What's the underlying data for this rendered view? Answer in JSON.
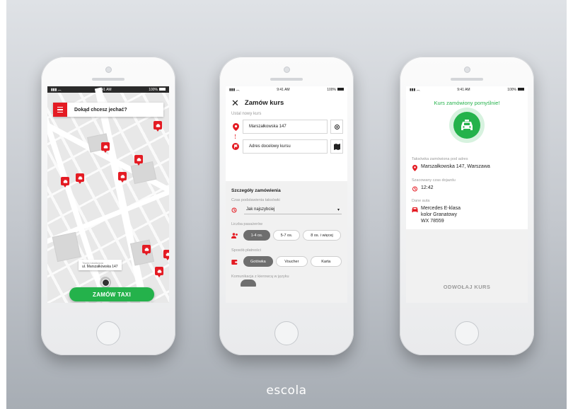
{
  "colors": {
    "brand_red": "#e41b23",
    "success_green": "#24b24b"
  },
  "status_bar": {
    "time": "9:41 AM",
    "battery": "100%"
  },
  "map_screen": {
    "search_placeholder": "Dokąd chcesz jechać?",
    "location_label": "Twoja lokalizacja",
    "location_value": "ul. Marszałkowska 147",
    "order_button": "ZAMÓW TAXI",
    "icons": [
      "menu-icon",
      "taxi-pin-icon",
      "current-location-icon"
    ]
  },
  "order_screen": {
    "title": "Zamów kurs",
    "subtitle": "Ustal nowy kurs",
    "from_value": "Marszałkowska 147",
    "to_placeholder": "Adres docelowy kursu",
    "details_title": "Szczegóły zamówienia",
    "time_label": "Czas podstawienia taksówki",
    "time_value": "Jak najszybciej",
    "passengers_label": "Liczba pasażerów",
    "passengers": [
      {
        "label": "1-4 os.",
        "selected": true
      },
      {
        "label": "5-7 os.",
        "selected": false
      },
      {
        "label": "8 os. i więcej",
        "selected": false
      }
    ],
    "payment_label": "Sposób płatności",
    "payment": [
      {
        "label": "Gotówka",
        "selected": true
      },
      {
        "label": "Voucher",
        "selected": false
      },
      {
        "label": "Karta",
        "selected": false
      }
    ],
    "language_label": "Komunikacja z kierowcą w języku"
  },
  "confirm_screen": {
    "title": "Kurs zamówiony pomyślnie!",
    "address_label": "Taksówka zamówiona pod adres",
    "address_value": "Marszałkowska 147, Warszawa",
    "eta_label": "Szacowany czas dojazdu",
    "eta_value": "12:42",
    "car_label": "Dane auta",
    "car_model": "Mercedes E-klasa",
    "car_color": "kolor Granatowy",
    "car_plate": "WX 78559",
    "cancel_button": "ODWOŁAJ KURS"
  },
  "brand": "escola"
}
